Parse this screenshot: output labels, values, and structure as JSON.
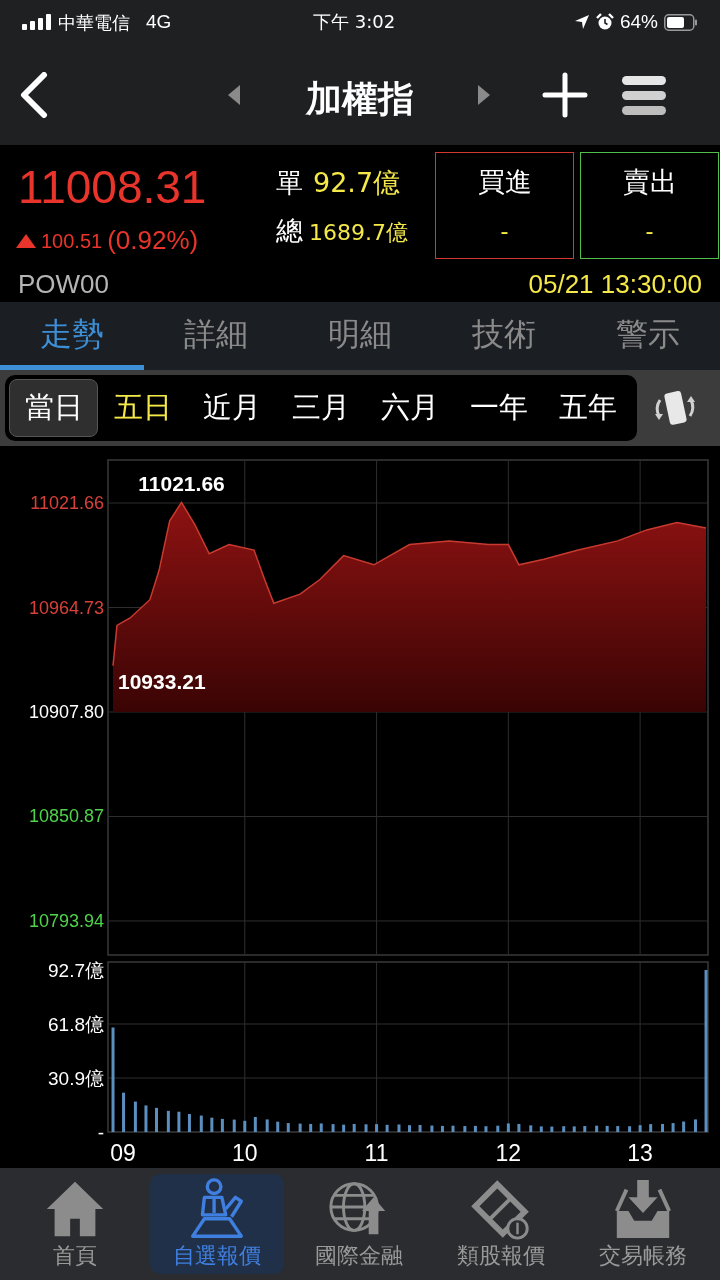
{
  "status_bar": {
    "carrier": "中華電信",
    "network": "4G",
    "time": "下午 3:02",
    "battery": "64%"
  },
  "header": {
    "title": "加權指"
  },
  "quote": {
    "price": "11008.31",
    "change": "100.51",
    "change_pct": "(0.92%)",
    "rising": true,
    "single_label": "單",
    "single_value": "92.7億",
    "total_label": "總",
    "total_value": "1689.7億",
    "code": "POW00",
    "datetime": "05/21 13:30:00"
  },
  "trade_buttons": [
    {
      "kind": "buy",
      "label": "買進",
      "value": "-"
    },
    {
      "kind": "sell",
      "label": "賣出",
      "value": "-"
    }
  ],
  "tabs": [
    {
      "label": "走勢",
      "selected": true
    },
    {
      "label": "詳細",
      "selected": false
    },
    {
      "label": "明細",
      "selected": false
    },
    {
      "label": "技術",
      "selected": false
    },
    {
      "label": "警示",
      "selected": false
    }
  ],
  "periods": [
    {
      "label": "當日",
      "selected": true,
      "highlighted": false
    },
    {
      "label": "五日",
      "selected": false,
      "highlighted": true
    },
    {
      "label": "近月",
      "selected": false,
      "highlighted": false
    },
    {
      "label": "三月",
      "selected": false,
      "highlighted": false
    },
    {
      "label": "六月",
      "selected": false,
      "highlighted": false
    },
    {
      "label": "一年",
      "selected": false,
      "highlighted": false
    },
    {
      "label": "五年",
      "selected": false,
      "highlighted": false
    }
  ],
  "price_chart": {
    "chart_data": {
      "type": "area",
      "grid": true,
      "xlim": [
        8.962,
        13.515
      ],
      "ylim": [
        10775.4,
        11045.1
      ],
      "yticks": [
        {
          "value": 11021.66,
          "label": "11021.66"
        },
        {
          "value": 10964.73,
          "label": "10964.73"
        },
        {
          "value": 10907.8,
          "label": "10907.80"
        },
        {
          "value": 10850.87,
          "label": "10850.87"
        },
        {
          "value": 10793.94,
          "label": "10793.94"
        }
      ],
      "x": [
        9,
        9.03,
        9.13,
        9.28,
        9.35,
        9.43,
        9.52,
        9.62,
        9.73,
        9.88,
        10.07,
        10.15,
        10.22,
        10.42,
        10.57,
        10.75,
        10.98,
        11.25,
        11.55,
        11.85,
        12,
        12.08,
        12.27,
        12.53,
        12.83,
        13.05,
        13.28,
        13.5
      ],
      "values": [
        10933,
        10955,
        10959,
        10969,
        10985,
        11012,
        11022,
        11010,
        10994,
        10999,
        10996,
        10980,
        10967,
        10972,
        10980,
        10993,
        10988,
        10999,
        11001,
        10999,
        10999,
        10988,
        10991,
        10996,
        11001,
        11007,
        11011,
        11008
      ],
      "annotations": [
        {
          "text": "11021.66",
          "x": 9.52,
          "y": 11021.66
        },
        {
          "text": "10933.21",
          "x": 9,
          "y": 10933.21
        }
      ]
    }
  },
  "volume_chart": {
    "chart_data": {
      "type": "bar",
      "grid": true,
      "xlim": [
        8.962,
        13.515
      ],
      "ylim": [
        0,
        92.7
      ],
      "yticks": [
        {
          "value": 92.7,
          "label": "92.7億"
        },
        {
          "value": 61.8,
          "label": "61.8億"
        },
        {
          "value": 30.9,
          "label": "30.9億"
        },
        {
          "value": 0,
          "label": "-"
        }
      ],
      "xticks": [
        {
          "value": 9,
          "label": "09"
        },
        {
          "value": 10,
          "label": "10"
        },
        {
          "value": 11,
          "label": "11"
        },
        {
          "value": 12,
          "label": "12"
        },
        {
          "value": 13,
          "label": "13"
        }
      ],
      "x": [
        9,
        9.08,
        9.17,
        9.25,
        9.33,
        9.42,
        9.5,
        9.58,
        9.67,
        9.75,
        9.83,
        9.92,
        10,
        10.08,
        10.17,
        10.25,
        10.33,
        10.42,
        10.5,
        10.58,
        10.67,
        10.75,
        10.83,
        10.92,
        11,
        11.08,
        11.17,
        11.25,
        11.33,
        11.42,
        11.5,
        11.58,
        11.67,
        11.75,
        11.83,
        11.92,
        12,
        12.08,
        12.17,
        12.25,
        12.33,
        12.42,
        12.5,
        12.58,
        12.67,
        12.75,
        12.83,
        12.92,
        13,
        13.08,
        13.17,
        13.25,
        13.33,
        13.42,
        13.5
      ],
      "values": [
        59.8,
        22.5,
        17.4,
        15.2,
        13.8,
        12.1,
        11.6,
        10.3,
        9.4,
        8.2,
        7.5,
        7.1,
        6.4,
        8.6,
        7.2,
        5.9,
        5.1,
        4.8,
        4.6,
        4.9,
        4.5,
        4.2,
        4.6,
        4.4,
        4.5,
        4.1,
        4.3,
        3.9,
        4.0,
        3.7,
        3.5,
        3.6,
        3.4,
        3.5,
        3.3,
        3.6,
        4.9,
        4.6,
        3.8,
        3.2,
        3.1,
        3.3,
        3.2,
        3.4,
        3.6,
        3.5,
        3.4,
        3.3,
        3.9,
        4.5,
        4.6,
        5.1,
        6.0,
        7.2,
        92.7
      ]
    }
  },
  "bottom_nav": [
    {
      "kind": "home",
      "label": "首頁",
      "selected": false
    },
    {
      "kind": "watchlist",
      "label": "自選報價",
      "selected": true
    },
    {
      "kind": "global",
      "label": "國際金融",
      "selected": false
    },
    {
      "kind": "sector",
      "label": "類股報價",
      "selected": false
    },
    {
      "kind": "account",
      "label": "交易帳務",
      "selected": false
    }
  ]
}
